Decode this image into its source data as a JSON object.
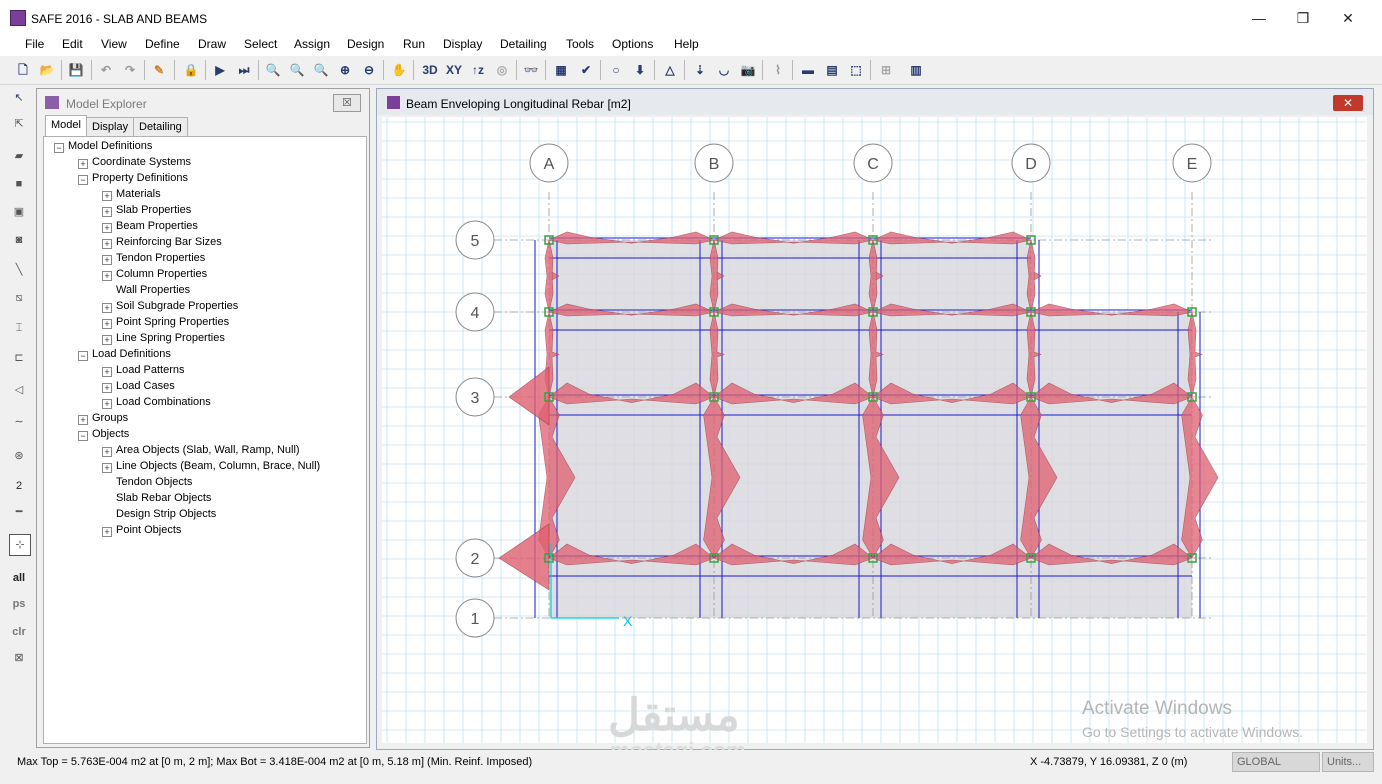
{
  "app": {
    "title": "SAFE 2016 - SLAB AND BEAMS",
    "minimize": "—",
    "restore": "❐",
    "close": "✕"
  },
  "menu": [
    "File",
    "Edit",
    "View",
    "Define",
    "Draw",
    "Select",
    "Assign",
    "Design",
    "Run",
    "Display",
    "Detailing",
    "Tools",
    "Options",
    "Help"
  ],
  "toolbar": {
    "label_3d": "3D",
    "label_xy": "XY",
    "label_tz": "↑z"
  },
  "left_tools": {
    "all": "all",
    "ps": "ps",
    "clr": "clr",
    "dim": "2"
  },
  "explorer": {
    "title": "Model Explorer",
    "close": "☒",
    "tabs": [
      "Model",
      "Display",
      "Detailing"
    ],
    "tree": [
      {
        "label": "Model Definitions",
        "level": 0,
        "expander": "−"
      },
      {
        "label": "Coordinate Systems",
        "level": 1,
        "expander": "+"
      },
      {
        "label": "Property Definitions",
        "level": 1,
        "expander": "−"
      },
      {
        "label": "Materials",
        "level": 2,
        "expander": "+"
      },
      {
        "label": "Slab Properties",
        "level": 2,
        "expander": "+"
      },
      {
        "label": "Beam Properties",
        "level": 2,
        "expander": "+"
      },
      {
        "label": "Reinforcing Bar Sizes",
        "level": 2,
        "expander": "+"
      },
      {
        "label": "Tendon Properties",
        "level": 2,
        "expander": "+"
      },
      {
        "label": "Column Properties",
        "level": 2,
        "expander": "+"
      },
      {
        "label": "Wall Properties",
        "level": 2,
        "expander": ""
      },
      {
        "label": "Soil Subgrade Properties",
        "level": 2,
        "expander": "+"
      },
      {
        "label": "Point Spring Properties",
        "level": 2,
        "expander": "+"
      },
      {
        "label": "Line Spring Properties",
        "level": 2,
        "expander": "+"
      },
      {
        "label": "Load Definitions",
        "level": 1,
        "expander": "−"
      },
      {
        "label": "Load Patterns",
        "level": 2,
        "expander": "+"
      },
      {
        "label": "Load Cases",
        "level": 2,
        "expander": "+"
      },
      {
        "label": "Load Combinations",
        "level": 2,
        "expander": "+"
      },
      {
        "label": "Groups",
        "level": 1,
        "expander": "+"
      },
      {
        "label": "Objects",
        "level": 1,
        "expander": "−"
      },
      {
        "label": "Area Objects (Slab, Wall, Ramp, Null)",
        "level": 2,
        "expander": "+"
      },
      {
        "label": "Line Objects (Beam, Column, Brace, Null)",
        "level": 2,
        "expander": "+"
      },
      {
        "label": "Tendon Objects",
        "level": 2,
        "expander": ""
      },
      {
        "label": "Slab Rebar Objects",
        "level": 2,
        "expander": ""
      },
      {
        "label": "Design Strip Objects",
        "level": 2,
        "expander": ""
      },
      {
        "label": "Point Objects",
        "level": 2,
        "expander": "+"
      }
    ]
  },
  "view": {
    "title": "Beam Enveloping Longitudinal Rebar  [m2]",
    "close": "✕",
    "grid_x": [
      "A",
      "B",
      "C",
      "D",
      "E"
    ],
    "grid_y": [
      "5",
      "4",
      "3",
      "2",
      "1"
    ],
    "axis_x": "X"
  },
  "status": {
    "left": "Max Top = 5.763E-004 m2 at [0 m, 2 m];  Max Bot = 3.418E-004 m2 at [0 m, 5.18 m]  (Min. Reinf. Imposed)",
    "coords": "X -4.73879,  Y 16.09381,  Z 0  (m)",
    "coord_system": "GLOBAL",
    "units": "Units..."
  },
  "watermark": {
    "line1": "Activate Windows",
    "line2": "Go to Settings to activate Windows."
  },
  "logo": {
    "text": "مستقل",
    "sub": "mostaqi.com"
  },
  "colors": {
    "accent_purple": "#7b3f99",
    "rebar_fill": "#e06070",
    "slab_fill": "#d8d8de",
    "beam_line": "#1a1ad0",
    "grid": "#a8d8f0",
    "column": "#3aa040"
  }
}
